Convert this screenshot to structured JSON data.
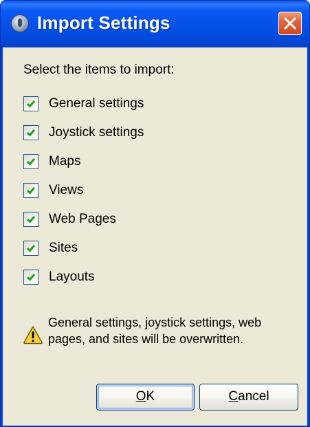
{
  "window": {
    "title": "Import Settings",
    "icons": {
      "app": "app-icon",
      "close": "close-icon"
    }
  },
  "dialog": {
    "prompt": "Select the items to import:",
    "options": [
      {
        "label": "General settings",
        "checked": true
      },
      {
        "label": "Joystick settings",
        "checked": true
      },
      {
        "label": "Maps",
        "checked": true
      },
      {
        "label": "Views",
        "checked": true
      },
      {
        "label": "Web Pages",
        "checked": true
      },
      {
        "label": "Sites",
        "checked": true
      },
      {
        "label": "Layouts",
        "checked": true
      }
    ],
    "warning": {
      "icon": "warning-icon",
      "text": "General settings, joystick settings, web pages, and sites will be overwritten."
    },
    "buttons": {
      "ok": {
        "mnemonic": "O",
        "rest": "K"
      },
      "cancel": {
        "mnemonic": "C",
        "rest": "ancel"
      }
    }
  },
  "colors": {
    "titlebar": "#0351e8",
    "client_bg": "#ece9d8",
    "check_mark": "#21a121",
    "close_button": "#e2643a"
  }
}
